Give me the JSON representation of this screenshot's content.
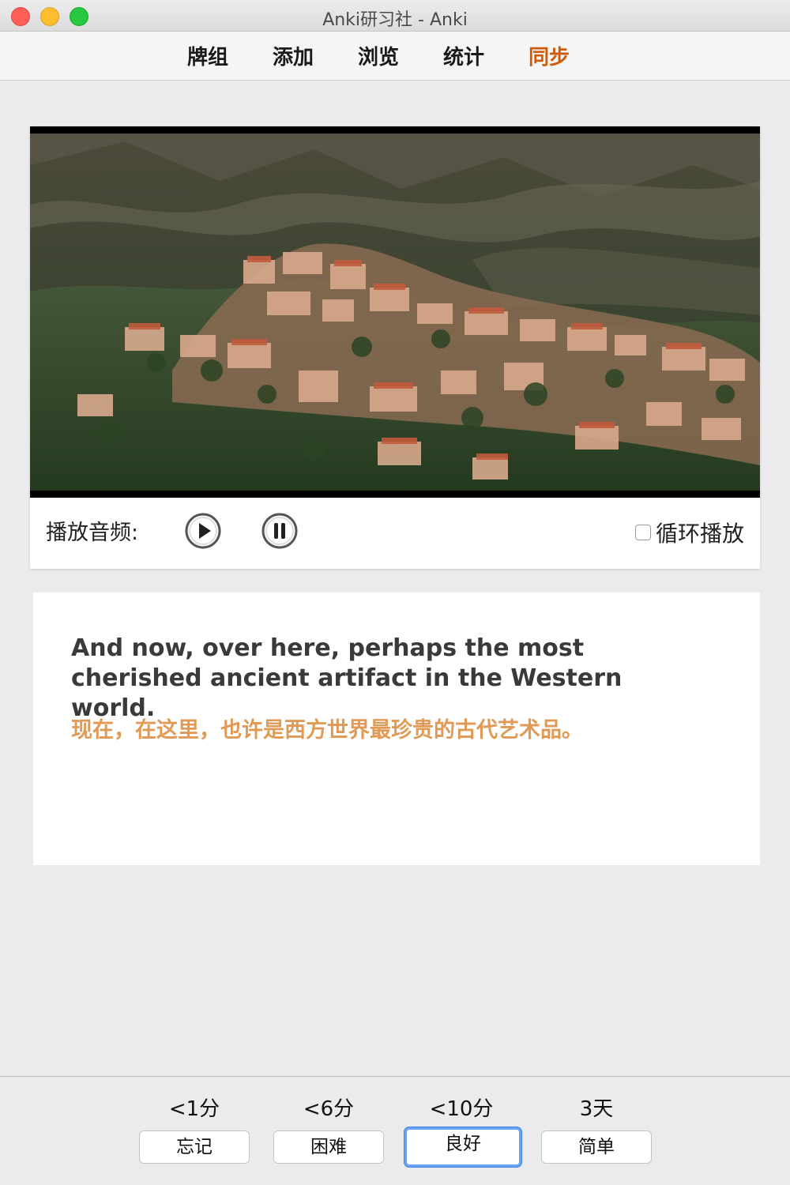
{
  "window": {
    "title": "Anki研习社 - Anki"
  },
  "toolbar": {
    "tabs": [
      {
        "label": "牌组"
      },
      {
        "label": "添加"
      },
      {
        "label": "浏览"
      },
      {
        "label": "统计"
      },
      {
        "label": "同步"
      }
    ],
    "active_tab": "同步",
    "active_color": "#cc5c0a"
  },
  "player": {
    "audio_label": "播放音频:",
    "play_icon": "play-icon",
    "pause_icon": "pause-icon",
    "loop_label": "循环播放",
    "loop_checked": false
  },
  "card": {
    "english": "And now, over here, perhaps the most cherished ancient artifact in the Western world.",
    "chinese": "现在，在这里，也许是西方世界最珍贵的古代艺术品。",
    "chinese_color": "#e09a55"
  },
  "answers": [
    {
      "interval": "<1分",
      "label": "忘记"
    },
    {
      "interval": "<6分",
      "label": "困难"
    },
    {
      "interval": "<10分",
      "label": "良好"
    },
    {
      "interval": "3天",
      "label": "简单"
    }
  ],
  "focused_answer": "良好"
}
